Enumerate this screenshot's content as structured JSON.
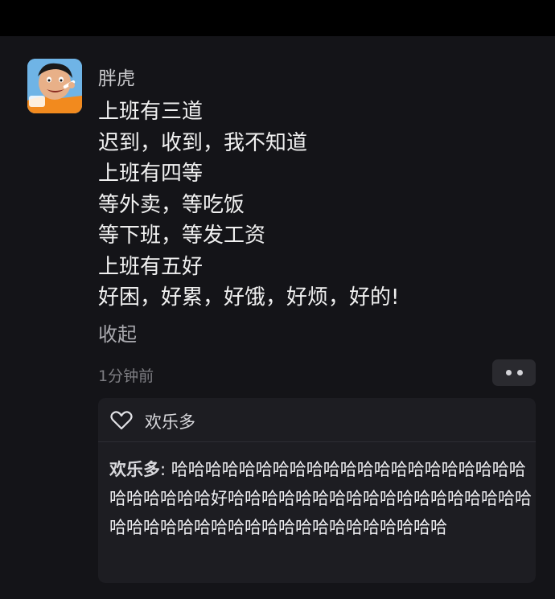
{
  "post": {
    "username": "胖虎",
    "lines": [
      "上班有三道",
      "迟到，收到，我不知道",
      "上班有四等",
      "等外卖，等吃饭",
      "等下班，等发工资",
      "上班有五好",
      "好困，好累，好饿，好烦，好的!"
    ],
    "collapse_label": "收起",
    "timestamp": "1分钟前"
  },
  "reactions": {
    "liked_by": "欢乐多",
    "comments": [
      {
        "author": "欢乐多",
        "separator": ": ",
        "text": "哈哈哈哈哈哈哈哈哈哈哈哈哈哈哈哈哈哈哈哈哈哈哈哈哈哈哈好哈哈哈哈哈哈哈哈哈哈哈哈哈哈哈哈哈哈哈哈哈哈哈哈哈哈哈哈哈哈哈哈哈哈哈哈哈哈"
      }
    ]
  },
  "colors": {
    "background": "#141418",
    "panel": "#1d1d22",
    "text": "#f0f0f0",
    "muted": "#7d7d82"
  },
  "icons": {
    "avatar": "cartoon-avatar",
    "more": "more-dots-icon",
    "like": "heart-icon"
  }
}
